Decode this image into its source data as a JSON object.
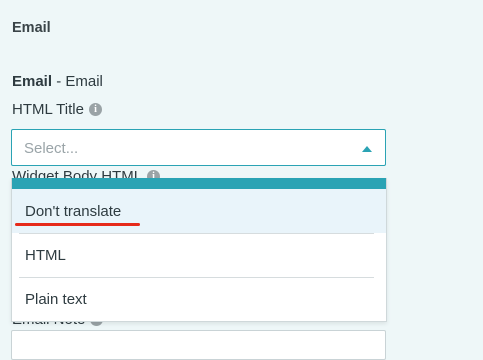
{
  "section": {
    "title": "Email"
  },
  "field": {
    "name": "Email",
    "separator": " - ",
    "type": "Email"
  },
  "html_title": {
    "label": "HTML Title",
    "select_placeholder": "Select..."
  },
  "widget_body": {
    "label": "Widget Body HTML"
  },
  "email_note": {
    "label": "Email Note"
  },
  "dropdown": {
    "options": [
      "Don't translate",
      "HTML",
      "Plain text"
    ],
    "highlighted_index": 0
  },
  "colors": {
    "accent": "#2aa3b4",
    "background": "#eef7f8",
    "annotation": "#e62a1a"
  },
  "icons": {
    "info": "info-circle-icon",
    "caret": "caret-up-icon"
  }
}
